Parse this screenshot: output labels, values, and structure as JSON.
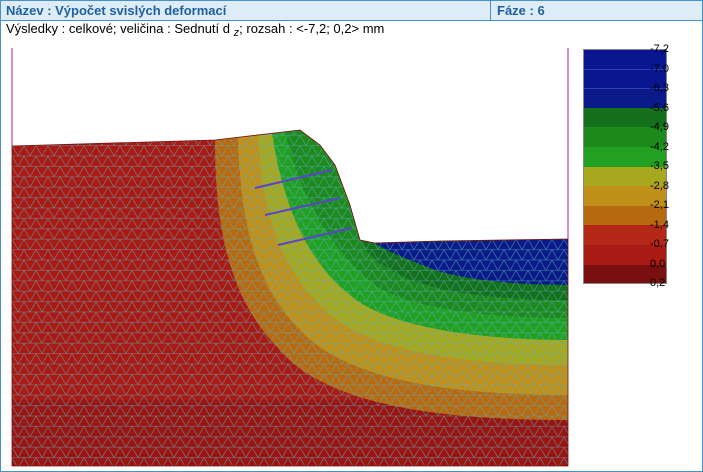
{
  "header": {
    "name_label": "Název : Výpočet svislých deformací",
    "phase_label": "Fáze : 6"
  },
  "subtitle": {
    "prefix": "Výsledky : celkové; veličina : Sednutí d",
    "subscript": "z",
    "suffix": "; rozsah : <-7,2; 0,2> mm"
  },
  "legend": {
    "labels": [
      "-7,2",
      "-7,0",
      "-6,3",
      "-5,6",
      "-4,9",
      "-4,2",
      "-3,5",
      "-2,8",
      "-2,1",
      "-1,4",
      "-0,7",
      "0,0",
      "0,2"
    ],
    "colors": [
      "#0a1590",
      "#0a1590",
      "#0a1a88",
      "#14701a",
      "#1e8a1e",
      "#22a022",
      "#a8a81e",
      "#c09018",
      "#b86a10",
      "#b52818",
      "#aa1a14",
      "#7a0f0f"
    ]
  },
  "mesh": {
    "line_color": "#5ab0c0",
    "anchor_color": "#5a44cc"
  }
}
